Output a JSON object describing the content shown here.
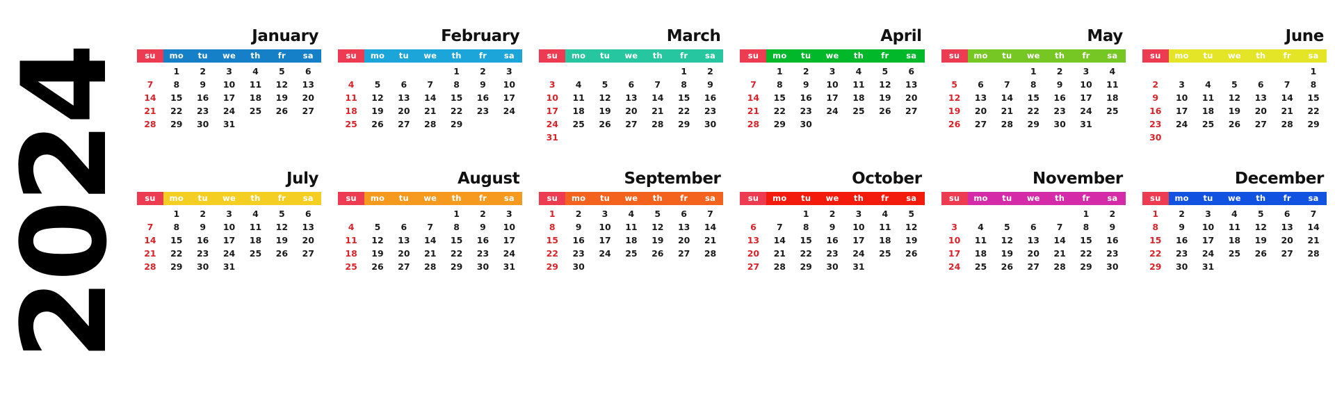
{
  "year": "2024",
  "colors": {
    "sunday_header_bg": "#ED3B52",
    "sunday_text": "#D8232A",
    "day_text": "#1a1a1a",
    "page_bg": "#ffffff",
    "title_text": "#111111"
  },
  "weekday_labels": [
    "su",
    "mo",
    "tu",
    "we",
    "th",
    "fr",
    "sa"
  ],
  "months": [
    {
      "name": "January",
      "accent": "#1580C8",
      "leading_blanks": 1,
      "days": 31,
      "weeks": [
        [
          "",
          "1",
          "2",
          "3",
          "4",
          "5",
          "6"
        ],
        [
          "7",
          "8",
          "9",
          "10",
          "11",
          "12",
          "13"
        ],
        [
          "14",
          "15",
          "16",
          "17",
          "18",
          "19",
          "20"
        ],
        [
          "21",
          "22",
          "23",
          "24",
          "25",
          "26",
          "27"
        ],
        [
          "28",
          "29",
          "30",
          "31",
          "",
          "",
          ""
        ]
      ]
    },
    {
      "name": "February",
      "accent": "#1CA5D8",
      "leading_blanks": 4,
      "days": 29,
      "weeks": [
        [
          "",
          "",
          "",
          "",
          "1",
          "2",
          "3"
        ],
        [
          "4",
          "5",
          "6",
          "7",
          "8",
          "9",
          "10"
        ],
        [
          "11",
          "12",
          "13",
          "14",
          "15",
          "16",
          "17"
        ],
        [
          "18",
          "19",
          "20",
          "21",
          "22",
          "23",
          "24"
        ],
        [
          "25",
          "26",
          "27",
          "28",
          "29",
          "",
          ""
        ]
      ]
    },
    {
      "name": "March",
      "accent": "#26C6A0",
      "leading_blanks": 5,
      "days": 31,
      "weeks": [
        [
          "",
          "",
          "",
          "",
          "",
          "1",
          "2"
        ],
        [
          "3",
          "4",
          "5",
          "6",
          "7",
          "8",
          "9"
        ],
        [
          "10",
          "11",
          "12",
          "13",
          "14",
          "15",
          "16"
        ],
        [
          "17",
          "18",
          "19",
          "20",
          "21",
          "22",
          "23"
        ],
        [
          "24",
          "25",
          "26",
          "27",
          "28",
          "29",
          "30"
        ],
        [
          "31",
          "",
          "",
          "",
          "",
          "",
          ""
        ]
      ]
    },
    {
      "name": "April",
      "accent": "#00B82A",
      "leading_blanks": 1,
      "days": 30,
      "weeks": [
        [
          "",
          "1",
          "2",
          "3",
          "4",
          "5",
          "6"
        ],
        [
          "7",
          "8",
          "9",
          "10",
          "11",
          "12",
          "13"
        ],
        [
          "14",
          "15",
          "16",
          "17",
          "18",
          "19",
          "20"
        ],
        [
          "21",
          "22",
          "23",
          "24",
          "25",
          "26",
          "27"
        ],
        [
          "28",
          "29",
          "30",
          "",
          "",
          "",
          ""
        ]
      ]
    },
    {
      "name": "May",
      "accent": "#76C724",
      "leading_blanks": 3,
      "days": 31,
      "weeks": [
        [
          "",
          "",
          "",
          "1",
          "2",
          "3",
          "4"
        ],
        [
          "5",
          "6",
          "7",
          "8",
          "9",
          "10",
          "11"
        ],
        [
          "12",
          "13",
          "14",
          "15",
          "16",
          "17",
          "18"
        ],
        [
          "19",
          "20",
          "21",
          "22",
          "23",
          "24",
          "25"
        ],
        [
          "26",
          "27",
          "28",
          "29",
          "30",
          "31",
          ""
        ]
      ]
    },
    {
      "name": "June",
      "accent": "#E4E526",
      "leading_blanks": 6,
      "days": 30,
      "weeks": [
        [
          "",
          "",
          "",
          "",
          "",
          "",
          "1"
        ],
        [
          "2",
          "3",
          "4",
          "5",
          "6",
          "7",
          "8"
        ],
        [
          "9",
          "10",
          "11",
          "12",
          "13",
          "14",
          "15"
        ],
        [
          "16",
          "17",
          "18",
          "19",
          "20",
          "21",
          "22"
        ],
        [
          "23",
          "24",
          "25",
          "26",
          "27",
          "28",
          "29"
        ],
        [
          "30",
          "",
          "",
          "",
          "",
          "",
          ""
        ]
      ]
    },
    {
      "name": "July",
      "accent": "#F5CE24",
      "leading_blanks": 1,
      "days": 31,
      "weeks": [
        [
          "",
          "1",
          "2",
          "3",
          "4",
          "5",
          "6"
        ],
        [
          "7",
          "8",
          "9",
          "10",
          "11",
          "12",
          "13"
        ],
        [
          "14",
          "15",
          "16",
          "17",
          "18",
          "19",
          "20"
        ],
        [
          "21",
          "22",
          "23",
          "24",
          "25",
          "26",
          "27"
        ],
        [
          "28",
          "29",
          "30",
          "31",
          "",
          "",
          ""
        ]
      ]
    },
    {
      "name": "August",
      "accent": "#F59A1E",
      "leading_blanks": 4,
      "days": 31,
      "weeks": [
        [
          "",
          "",
          "",
          "",
          "1",
          "2",
          "3"
        ],
        [
          "4",
          "5",
          "6",
          "7",
          "8",
          "9",
          "10"
        ],
        [
          "11",
          "12",
          "13",
          "14",
          "15",
          "16",
          "17"
        ],
        [
          "18",
          "19",
          "20",
          "21",
          "22",
          "23",
          "24"
        ],
        [
          "25",
          "26",
          "27",
          "28",
          "29",
          "30",
          "31"
        ]
      ]
    },
    {
      "name": "September",
      "accent": "#F4631E",
      "leading_blanks": 0,
      "days": 30,
      "weeks": [
        [
          "1",
          "2",
          "3",
          "4",
          "5",
          "6",
          "7"
        ],
        [
          "8",
          "9",
          "10",
          "11",
          "12",
          "13",
          "14"
        ],
        [
          "15",
          "16",
          "17",
          "18",
          "19",
          "20",
          "21"
        ],
        [
          "22",
          "23",
          "24",
          "25",
          "26",
          "27",
          "28"
        ],
        [
          "29",
          "30",
          "",
          "",
          "",
          "",
          ""
        ]
      ]
    },
    {
      "name": "October",
      "accent": "#F21B0C",
      "leading_blanks": 2,
      "days": 31,
      "weeks": [
        [
          "",
          "",
          "1",
          "2",
          "3",
          "4",
          "5"
        ],
        [
          "6",
          "7",
          "8",
          "9",
          "10",
          "11",
          "12"
        ],
        [
          "13",
          "14",
          "15",
          "16",
          "17",
          "18",
          "19"
        ],
        [
          "20",
          "21",
          "22",
          "23",
          "24",
          "25",
          "26"
        ],
        [
          "27",
          "28",
          "29",
          "30",
          "31",
          "",
          ""
        ]
      ]
    },
    {
      "name": "November",
      "accent": "#D42BA8",
      "leading_blanks": 5,
      "days": 30,
      "weeks": [
        [
          "",
          "",
          "",
          "",
          "",
          "1",
          "2"
        ],
        [
          "3",
          "4",
          "5",
          "6",
          "7",
          "8",
          "9"
        ],
        [
          "10",
          "11",
          "12",
          "13",
          "14",
          "15",
          "16"
        ],
        [
          "17",
          "18",
          "19",
          "20",
          "21",
          "22",
          "23"
        ],
        [
          "24",
          "25",
          "26",
          "27",
          "28",
          "29",
          "30"
        ]
      ]
    },
    {
      "name": "December",
      "accent": "#1152E0",
      "leading_blanks": 0,
      "days": 31,
      "weeks": [
        [
          "1",
          "2",
          "3",
          "4",
          "5",
          "6",
          "7"
        ],
        [
          "8",
          "9",
          "10",
          "11",
          "12",
          "13",
          "14"
        ],
        [
          "15",
          "16",
          "17",
          "18",
          "19",
          "20",
          "21"
        ],
        [
          "22",
          "23",
          "24",
          "25",
          "26",
          "27",
          "28"
        ],
        [
          "29",
          "30",
          "31",
          "",
          "",
          "",
          ""
        ]
      ]
    }
  ]
}
